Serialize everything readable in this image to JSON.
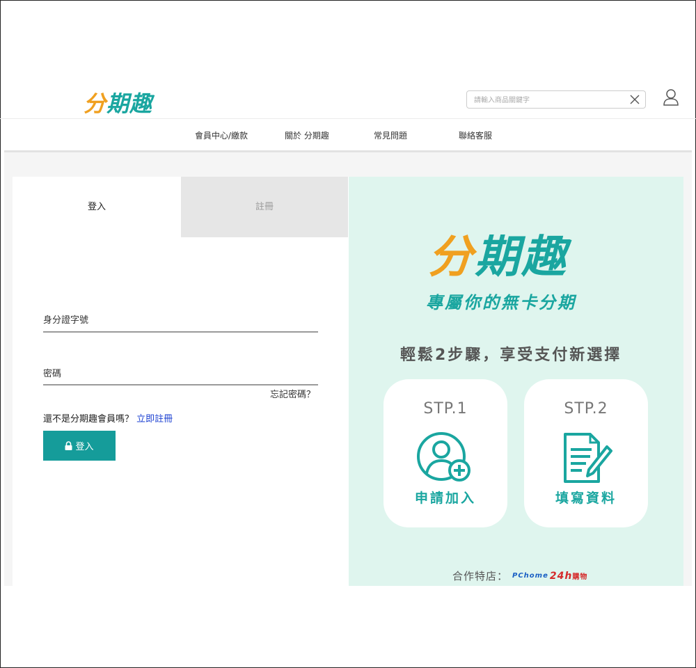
{
  "brand": {
    "logo_part1": "分",
    "logo_part2": "期趣"
  },
  "search": {
    "placeholder": "請輸入商品關鍵字"
  },
  "icons": {
    "clear": "close-icon",
    "user": "user-icon",
    "lock": "lock-icon"
  },
  "nav": {
    "items": [
      {
        "label": "會員中心/繳款"
      },
      {
        "label": "關於 分期趣"
      },
      {
        "label": "常見問題"
      },
      {
        "label": "聯絡客服"
      }
    ]
  },
  "tabs": {
    "login": "登入",
    "register": "註冊"
  },
  "form": {
    "id_label": "身分證字號",
    "id_value": "",
    "password_label": "密碼",
    "password_value": "",
    "forgot": "忘記密碼？",
    "not_member": "還不是分期趣會員嗎？",
    "register_link": "立即註冊",
    "login_button": "登入"
  },
  "promo": {
    "logo_part1": "分",
    "logo_part2": "期趣",
    "tagline": "專屬你的無卡分期",
    "subtitle": "輕鬆2步驟，享受支付新選擇",
    "steps": [
      {
        "label": "STP.1",
        "caption": "申請加入",
        "icon": "user-add-icon"
      },
      {
        "label": "STP.2",
        "caption": "填寫資料",
        "icon": "document-edit-icon"
      }
    ],
    "partner_label": "合作特店：",
    "partner_logo_a": "PChome",
    "partner_logo_b": "24h",
    "partner_logo_c": "購物"
  },
  "colors": {
    "accent": "#159c9a",
    "brand_orange": "#f0a020",
    "promo_bg": "#dff5ee",
    "link": "#1a3fd1"
  }
}
